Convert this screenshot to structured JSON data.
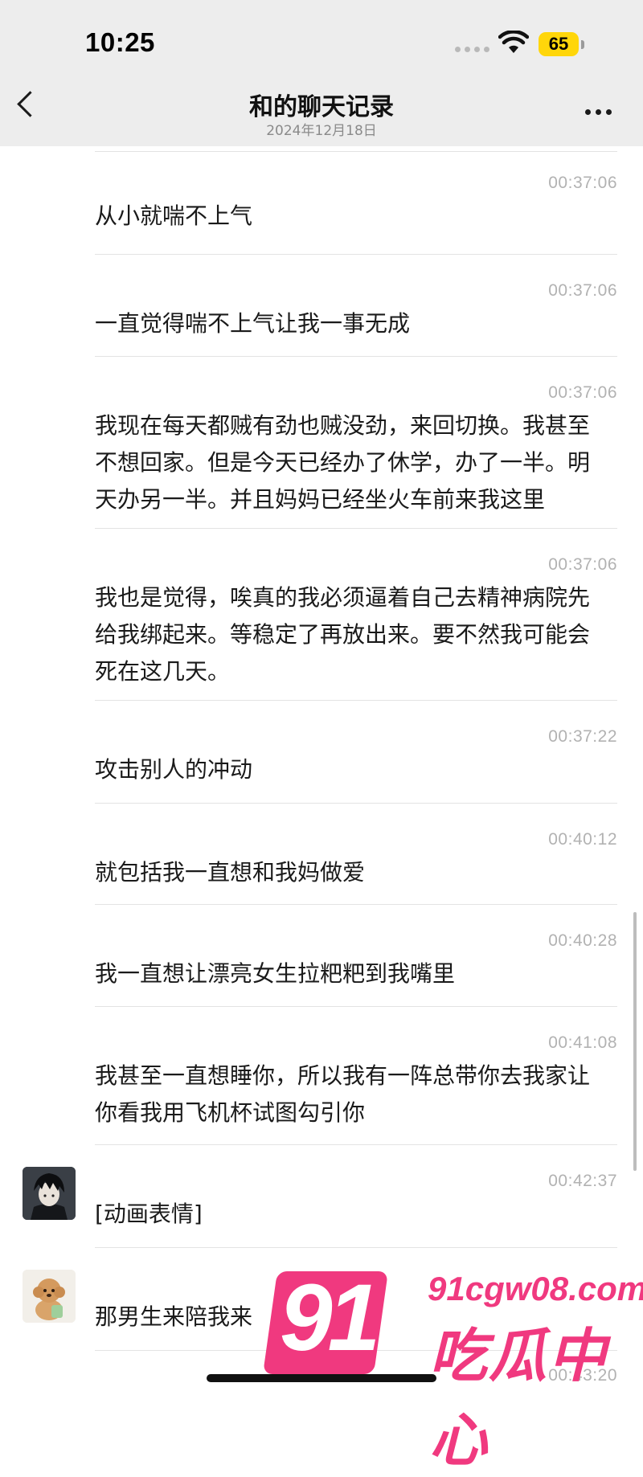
{
  "status_bar": {
    "time": "10:25",
    "battery": "65"
  },
  "nav": {
    "title": "和的聊天记录",
    "subtitle": "2024年12月18日"
  },
  "messages": [
    {
      "time": "00:37:06",
      "text": "从小就喘不上气"
    },
    {
      "time": "00:37:06",
      "text": "一直觉得喘不上气让我一事无成"
    },
    {
      "time": "00:37:06",
      "text": "我现在每天都贼有劲也贼没劲，来回切换。我甚至\n不想回家。但是今天已经办了休学，办了一半。明\n天办另一半。并且妈妈已经坐火车前来我这里"
    },
    {
      "time": "00:37:06",
      "text": "我也是觉得，唉真的我必须逼着自己去精神病院先\n给我绑起来。等稳定了再放出来。要不然我可能会\n死在这几天。"
    },
    {
      "time": "00:37:22",
      "text": "攻击别人的冲动"
    },
    {
      "time": "00:40:12",
      "text": "就包括我一直想和我妈做爱"
    },
    {
      "time": "00:40:28",
      "text": "我一直想让漂亮女生拉粑粑到我嘴里"
    },
    {
      "time": "00:41:08",
      "text": "我甚至一直想睡你，所以我有一阵总带你去我家让\n你看我用飞机杯试图勾引你"
    },
    {
      "time": "00:42:37",
      "text": "[动画表情]"
    },
    {
      "time": "",
      "text": "那男生来陪我来"
    },
    {
      "time": "00:43:20",
      "text": ""
    }
  ],
  "watermark": {
    "number": "91",
    "url": "91cgw08.com",
    "name": "吃瓜中心"
  },
  "colors": {
    "accent": "#f0397f",
    "battery": "#ffd60a",
    "topbar": "#ededed"
  },
  "icons": [
    "back-icon",
    "more-icon",
    "wifi-icon",
    "signal-icon",
    "battery-icon"
  ]
}
